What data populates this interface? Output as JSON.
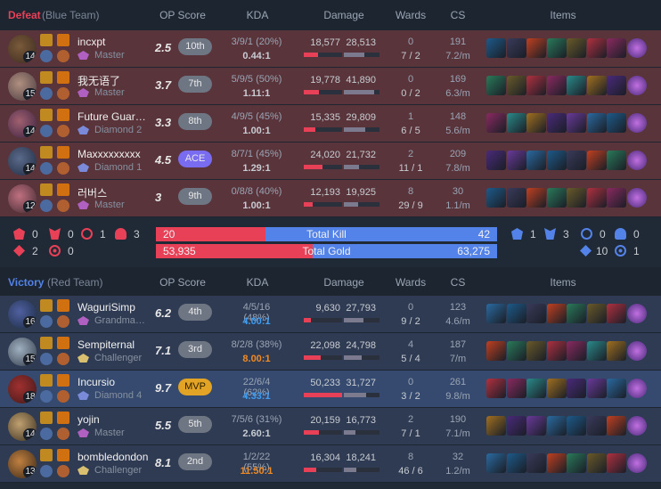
{
  "defeat_header": {
    "result": "Defeat",
    "team": "(Blue Team)",
    "op_score": "OP Score",
    "kda": "KDA",
    "damage": "Damage",
    "wards": "Wards",
    "cs": "CS",
    "items": "Items"
  },
  "victory_header": {
    "result": "Victory",
    "team": "(Red Team)",
    "op_score": "OP Score",
    "kda": "KDA",
    "damage": "Damage",
    "wards": "Wards",
    "cs": "CS",
    "items": "Items"
  },
  "colors": {
    "defeat_accent": "#e84057",
    "victory_accent": "#5383e8",
    "defeat_row": "#59343b",
    "victory_row": "#2f3b53",
    "victory_row_highlight": "#354a6e",
    "ace_badge": "#7a6cf0",
    "mvp_badge": "#e3a325",
    "damage_dealt_bar": "#e84057",
    "damage_taken_bar": "#7b7a8e",
    "victory_dealt_bar": "#5383e8"
  },
  "defeat_players": [
    {
      "level": "14",
      "name": "incxpt",
      "tier": "Master",
      "score": "2.5",
      "rank": "10th",
      "kda": "3/9/1 (20%)",
      "ratio": "0.44:1",
      "dealt": "18,577",
      "taken": "28,513",
      "dealt_frac": 0.37,
      "taken_frac": 0.57,
      "wards": "0",
      "wards2": "7 / 2",
      "cs": "191",
      "csm": "7.2/m"
    },
    {
      "level": "15",
      "name": "我无语了",
      "tier": "Master",
      "score": "3.7",
      "rank": "7th",
      "kda": "5/9/5 (50%)",
      "ratio": "1.11:1",
      "dealt": "19,778",
      "taken": "41,890",
      "dealt_frac": 0.39,
      "taken_frac": 0.84,
      "wards": "0",
      "wards2": "0 / 2",
      "cs": "169",
      "csm": "6.3/m"
    },
    {
      "level": "14",
      "name": "Future Guardian",
      "tier": "Diamond 2",
      "score": "3.3",
      "rank": "8th",
      "kda": "4/9/5 (45%)",
      "ratio": "1.00:1",
      "dealt": "15,335",
      "taken": "29,809",
      "dealt_frac": 0.31,
      "taken_frac": 0.6,
      "wards": "1",
      "wards2": "6 / 5",
      "cs": "148",
      "csm": "5.6/m"
    },
    {
      "level": "14",
      "name": "Maxxxxxxxxx",
      "tier": "Diamond 1",
      "score": "4.5",
      "rank": "ACE",
      "kda": "8/7/1 (45%)",
      "ratio": "1.29:1",
      "dealt": "24,020",
      "taken": "21,732",
      "dealt_frac": 0.48,
      "taken_frac": 0.43,
      "wards": "2",
      "wards2": "11 / 1",
      "cs": "209",
      "csm": "7.8/m"
    },
    {
      "level": "12",
      "name": "러버스",
      "tier": "Master",
      "score": "3",
      "rank": "9th",
      "kda": "0/8/8 (40%)",
      "ratio": "1.00:1",
      "dealt": "12,193",
      "taken": "19,925",
      "dealt_frac": 0.24,
      "taken_frac": 0.4,
      "wards": "8",
      "wards2": "29 / 9",
      "cs": "30",
      "csm": "1.1/m"
    }
  ],
  "victory_players": [
    {
      "level": "16",
      "name": "WaguriSimp",
      "tier": "Grandmaster",
      "score": "6.2",
      "rank": "4th",
      "kda": "4/5/16 (48%)",
      "ratio": "4.00:1",
      "dealt": "9,630",
      "taken": "27,793",
      "dealt_frac": 0.19,
      "taken_frac": 0.55,
      "wards": "0",
      "wards2": "9 / 2",
      "cs": "123",
      "csm": "4.6/m"
    },
    {
      "level": "15",
      "name": "Sempiternal",
      "tier": "Challenger",
      "score": "7.1",
      "rank": "3rd",
      "kda": "8/2/8 (38%)",
      "ratio": "8.00:1",
      "dealt": "22,098",
      "taken": "24,798",
      "dealt_frac": 0.44,
      "taken_frac": 0.49,
      "wards": "4",
      "wards2": "5 / 4",
      "cs": "187",
      "csm": "7/m"
    },
    {
      "level": "18",
      "name": "Incursio",
      "tier": "Diamond 4",
      "score": "9.7",
      "rank": "MVP",
      "kda": "22/6/4 (62%)",
      "ratio": "4.33:1",
      "dealt": "50,233",
      "taken": "31,727",
      "dealt_frac": 1.0,
      "taken_frac": 0.63,
      "wards": "0",
      "wards2": "3 / 2",
      "cs": "261",
      "csm": "9.8/m"
    },
    {
      "level": "14",
      "name": "yojin",
      "tier": "Master",
      "score": "5.5",
      "rank": "5th",
      "kda": "7/5/6 (31%)",
      "ratio": "2.60:1",
      "dealt": "20,159",
      "taken": "16,773",
      "dealt_frac": 0.4,
      "taken_frac": 0.33,
      "wards": "2",
      "wards2": "7 / 1",
      "cs": "190",
      "csm": "7.1/m"
    },
    {
      "level": "13",
      "name": "bombledondon",
      "tier": "Challenger",
      "score": "8.1",
      "rank": "2nd",
      "kda": "1/2/22 (55%)",
      "ratio": "11.50:1",
      "dealt": "16,304",
      "taken": "18,241",
      "dealt_frac": 0.32,
      "taken_frac": 0.36,
      "wards": "8",
      "wards2": "46 / 6",
      "cs": "32",
      "csm": "1.2/m"
    }
  ],
  "summary": {
    "total_kill_label": "Total Kill",
    "total_gold_label": "Total Gold",
    "blue_kills": "20",
    "red_kills": "42",
    "blue_gold": "53,935",
    "red_gold": "63,275",
    "blue_kill_frac": 0.32,
    "blue_gold_frac": 0.46,
    "blue_obj": {
      "baron": "0",
      "dragon": "0",
      "herald": "1",
      "tower": "3",
      "grubs": "2",
      "inhib": "0"
    },
    "red_obj": {
      "baron": "1",
      "dragon": "3",
      "herald": "0",
      "tower": "0",
      "grubs": "10",
      "inhib": "1"
    }
  }
}
